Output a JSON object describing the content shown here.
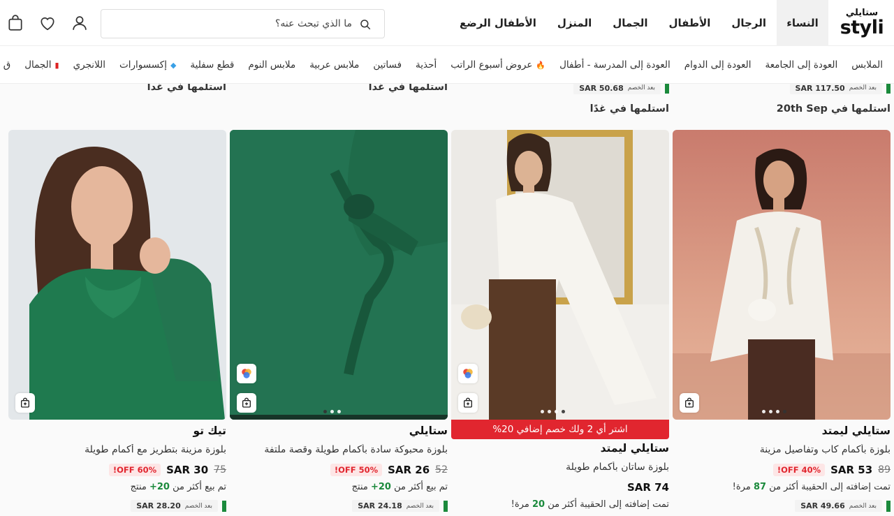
{
  "header": {
    "logo_ar": "ستايلي",
    "logo_en": "styli",
    "categories": [
      "النساء",
      "الرجال",
      "الأطفال",
      "الجمال",
      "المنزل",
      "الأطفال الرضع"
    ],
    "search_placeholder": "ما الذي تبحث عنه؟"
  },
  "subnav": {
    "items": [
      "الملابس",
      "العودة إلى الجامعة",
      "العودة إلى الدوام",
      "العودة إلى المدرسة - أطفال",
      "عروض أسبوع الراتب",
      "أحذية",
      "فساتين",
      "ملابس عربية",
      "ملابس النوم",
      "قطع سفلية",
      "إكسسوارات",
      "اللانجري",
      "الجمال",
      "ق"
    ]
  },
  "discount_label": "بعد الخصم",
  "products": [
    {
      "top_discount": "SAR 117.50",
      "delivery": "استلمها في 20th Sep",
      "brand": "ستايلي ليمتد",
      "title": "بلوزة بأكمام كاب وتفاصيل مزينة",
      "price": "SAR 53",
      "old_price": "89",
      "off": "40% OFF!",
      "social_pre": "تمت إضافته إلى الحقيبة أكثر من",
      "social_num": "87",
      "social_post": "مرة!",
      "discount_price": "SAR 49.66"
    },
    {
      "top_discount": "SAR 50.68",
      "delivery": "استلمها في غدًا",
      "brand": "ستايلي ليمتد",
      "title": "بلوزة ساتان بأكمام طويلة",
      "price": "SAR 74",
      "promo": "اشتر أي 2 ولك خصم إضافي 20%",
      "social_pre": "تمت إضافته إلى الحقيبة أكثر من",
      "social_num": "20",
      "social_post": "مرة!"
    },
    {
      "delivery": "استلمها في غدا",
      "brand": "ستايلي",
      "title": "بلوزة محبوكة سادة بأكمام طويلة وقصة ملتفة",
      "price": "SAR 26",
      "old_price": "52",
      "off": "50% OFF!",
      "social_pre": "تم بيع أكثر من",
      "social_num": "20+",
      "social_post": "منتج",
      "discount_price": "SAR 24.18"
    },
    {
      "delivery": "استلمها في غدا",
      "brand": "تيك تو",
      "title": "بلوزة مزينة بتطريز مع أكمام طويلة",
      "price": "SAR 30",
      "old_price": "75",
      "off": "60% OFF!",
      "social_pre": "تم بيع أكثر من",
      "social_num": "20+",
      "social_post": "منتج",
      "discount_price": "SAR 28.20"
    }
  ]
}
